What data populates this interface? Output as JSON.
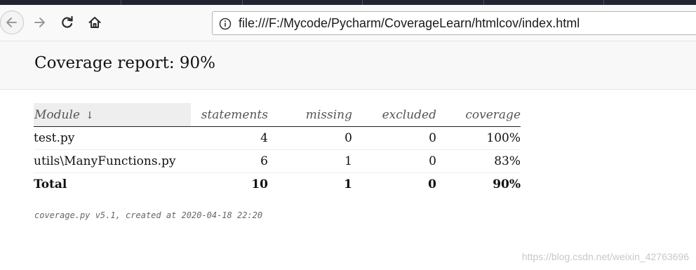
{
  "browser": {
    "url": "file:///F:/Mycode/Pycharm/CoverageLearn/htmlcov/index.html"
  },
  "page": {
    "title": "Coverage report: 90%"
  },
  "table": {
    "headers": {
      "module": "Module",
      "sort_indicator": "↓",
      "statements": "statements",
      "missing": "missing",
      "excluded": "excluded",
      "coverage": "coverage"
    },
    "rows": [
      {
        "module": "test.py",
        "statements": "4",
        "missing": "0",
        "excluded": "0",
        "coverage": "100%"
      },
      {
        "module": "utils\\ManyFunctions.py",
        "statements": "6",
        "missing": "1",
        "excluded": "0",
        "coverage": "83%"
      }
    ],
    "total": {
      "module": "Total",
      "statements": "10",
      "missing": "1",
      "excluded": "0",
      "coverage": "90%"
    }
  },
  "footer": {
    "text": "coverage.py v5.1, created at 2020-04-18 22:20"
  },
  "watermark": "https://blog.csdn.net/weixin_42763696",
  "icons": {
    "back": "back-arrow-icon",
    "forward": "forward-arrow-icon",
    "reload": "reload-icon",
    "home": "home-icon",
    "info": "info-icon"
  }
}
